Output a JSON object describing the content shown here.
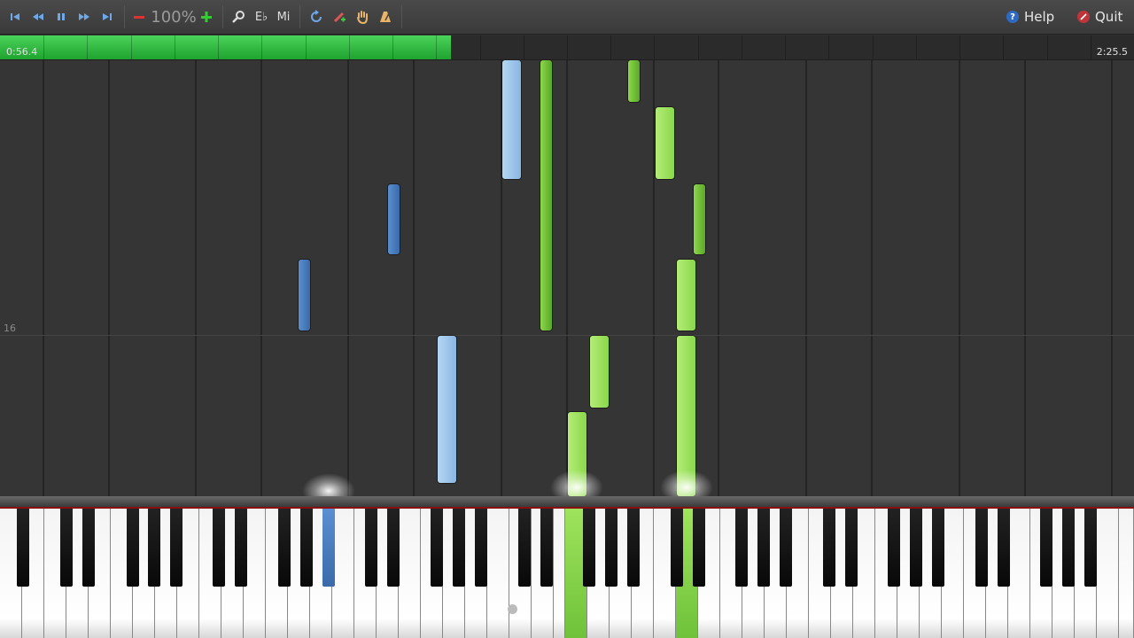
{
  "toolbar": {
    "zoom_label": "100%",
    "eb_label": "E♭",
    "mi_label": "Mi",
    "help_label": "Help",
    "quit_label": "Quit",
    "help_icon_glyph": "?"
  },
  "timeline": {
    "current_time": "0:56.4",
    "total_time": "2:25.5",
    "progress": 0.398
  },
  "roll": {
    "measure_number": "16"
  },
  "colors": {
    "left_hand": "#4a7ec0",
    "left_hand_light": "#9cc4ea",
    "right_hand": "#78c73a",
    "right_hand_light": "#9be25a",
    "progress": "#2bbf3a",
    "quit_icon": "#c0353a",
    "help_icon": "#2f6ac2"
  }
}
